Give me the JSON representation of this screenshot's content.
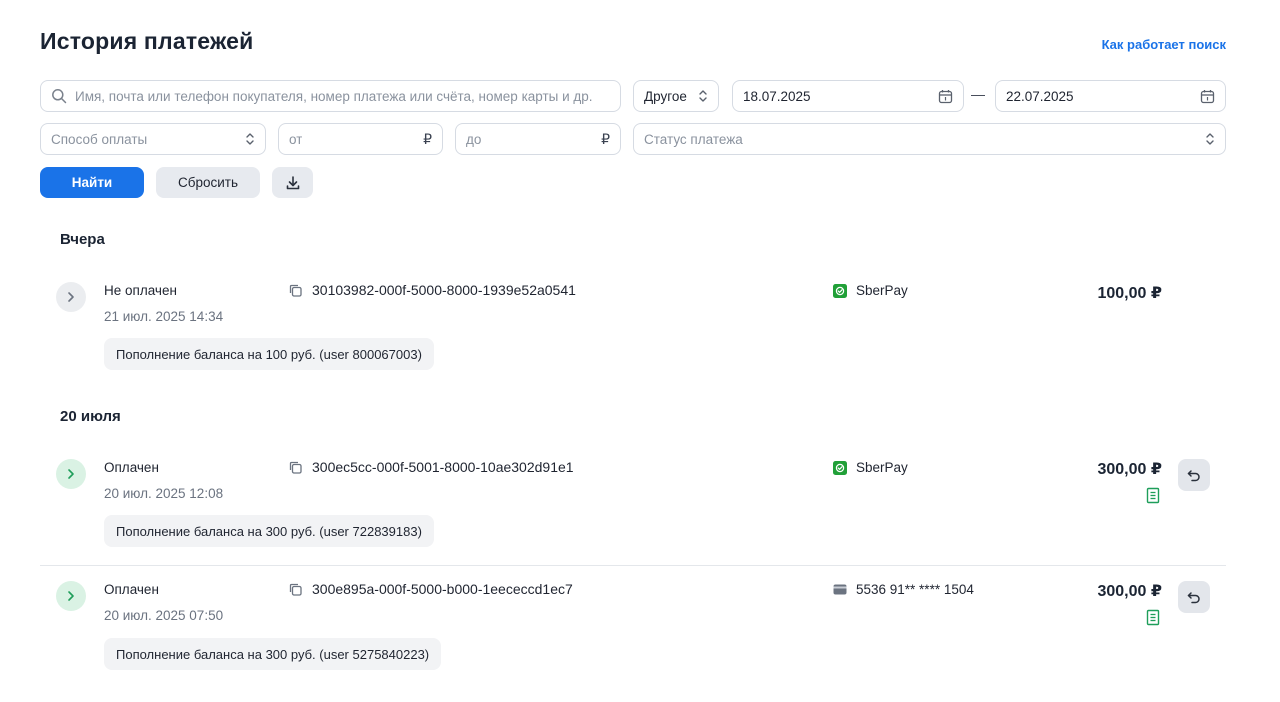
{
  "header": {
    "title": "История платежей",
    "help_link": "Как работает поиск"
  },
  "filters": {
    "search_placeholder": "Имя, почта или телефон покупателя, номер платежа или счёта, номер карты и др.",
    "period_type": "Другое",
    "date_from": "18.07.2025",
    "date_separator": "—",
    "date_to": "22.07.2025",
    "payment_method_placeholder": "Способ оплаты",
    "amount_from_placeholder": "от",
    "amount_to_placeholder": "до",
    "currency_symbol": "₽",
    "status_placeholder": "Статус платежа",
    "find_label": "Найти",
    "reset_label": "Сбросить"
  },
  "groups": [
    {
      "title": "Вчера",
      "payments": [
        {
          "status": "Не оплачен",
          "datetime": "21 июл. 2025 14:34",
          "payment_id": "30103982-000f-5000-8000-1939e52a0541",
          "method": "SberPay",
          "method_icon": "sberpay-icon",
          "amount": "100,00 ₽",
          "description": "Пополнение баланса на 100 руб. (user 800067003)",
          "paid": false
        }
      ]
    },
    {
      "title": "20 июля",
      "payments": [
        {
          "status": "Оплачен",
          "datetime": "20 июл. 2025 12:08",
          "payment_id": "300ec5cc-000f-5001-8000-10ae302d91e1",
          "method": "SberPay",
          "method_icon": "sberpay-icon",
          "amount": "300,00 ₽",
          "description": "Пополнение баланса на 300 руб. (user 722839183)",
          "paid": true
        },
        {
          "status": "Оплачен",
          "datetime": "20 июл. 2025 07:50",
          "payment_id": "300e895a-000f-5000-b000-1eececcd1ec7",
          "method": "5536 91** **** 1504",
          "method_icon": "bank-card-icon",
          "amount": "300,00 ₽",
          "description": "Пополнение баланса на 300 руб. (user 5275840223)",
          "paid": true
        }
      ]
    }
  ],
  "colors": {
    "accent": "#1a73e8",
    "paid_green": "#1e9e5a",
    "sberpay_green": "#21a038"
  }
}
